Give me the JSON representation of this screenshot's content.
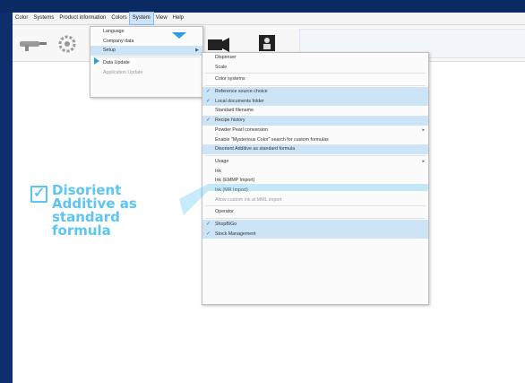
{
  "menubar": {
    "items": [
      "Color",
      "Systems",
      "Product information",
      "Colors",
      "System",
      "View",
      "Help"
    ],
    "active_index": 4
  },
  "system_menu": {
    "items": [
      {
        "label": "Language",
        "selected": false
      },
      {
        "label": "Company data",
        "selected": false
      },
      {
        "label": "Setup",
        "selected": true,
        "submenu": true
      },
      {
        "label": "Data Update",
        "selected": false
      },
      {
        "label": "Application Update",
        "selected": false,
        "disabled": true
      }
    ]
  },
  "setup_menu": {
    "items": [
      {
        "label": "Dispenser",
        "checked": false
      },
      {
        "label": "Scale",
        "checked": false
      },
      {
        "label": "Color systems",
        "checked": false
      },
      {
        "label": "Reference source choice",
        "checked": true
      },
      {
        "label": "Local documents folder",
        "checked": true
      },
      {
        "label": "Standard filename",
        "checked": false
      },
      {
        "label": "Recipe history",
        "checked": true
      },
      {
        "label": "Powder Pearl conversion",
        "checked": false,
        "submenu": true
      },
      {
        "label": "Enable \"Mysterious Color\" search for custom formulas",
        "checked": false
      },
      {
        "label": "Disorient Additive as standard formula",
        "checked": false,
        "selected": true
      },
      {
        "label": "Usage",
        "checked": false,
        "submenu": true
      },
      {
        "label": "Ink",
        "checked": false
      },
      {
        "label": "Ink (EMMP Import)",
        "checked": false
      },
      {
        "label": "Ink (MR Import)",
        "checked": false
      },
      {
        "label": "Allow custom ink at MML import",
        "checked": false,
        "disabled": true
      },
      {
        "label": "Operator",
        "checked": false
      },
      {
        "label": "ShopBiGo",
        "checked": true
      },
      {
        "label": "Stock Management",
        "checked": true
      }
    ]
  },
  "callout": {
    "lines": [
      "Disorient",
      "Additive as",
      "standard",
      "formula"
    ]
  },
  "colors": {
    "background": "#0d2f6b",
    "accent": "#5cc6f2",
    "highlight": "#cde4f7"
  }
}
